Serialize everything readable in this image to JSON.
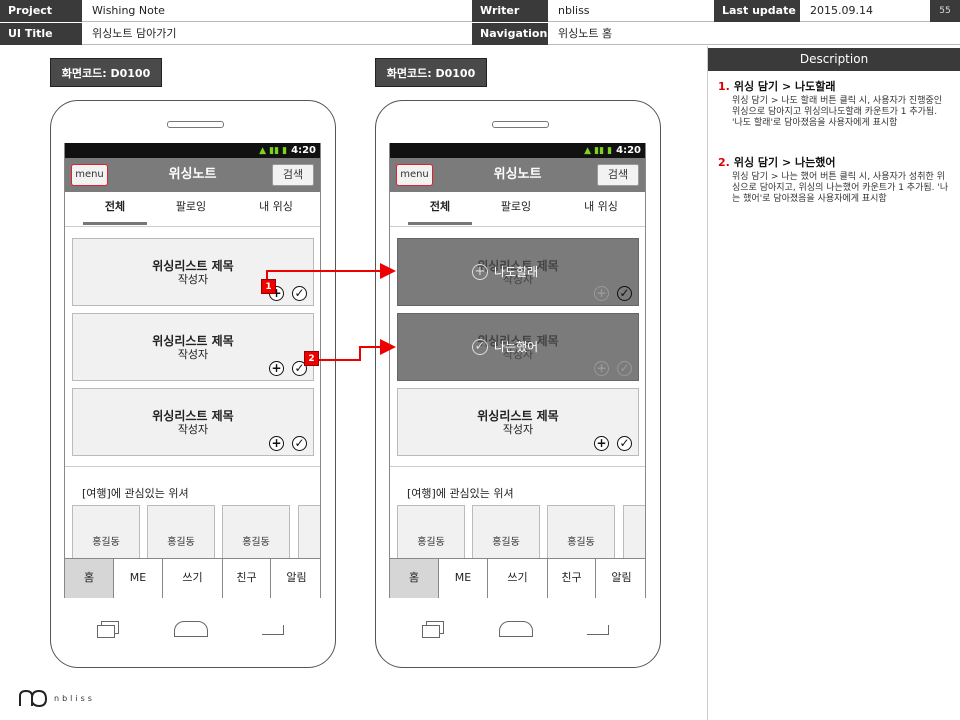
{
  "header": {
    "project_label": "Project",
    "project_value": "Wishing Note",
    "writer_label": "Writer",
    "writer_value": "nbliss",
    "last_update_label": "Last update",
    "last_update_value": "2015.09.14",
    "page_number": "55",
    "ui_title_label": "UI Title",
    "ui_title_value": "위싱노트 담아가기",
    "navigation_label": "Navigation",
    "navigation_value": "위싱노트 홈"
  },
  "screens": [
    {
      "code": "화면코드: D0100"
    },
    {
      "code": "화면코드: D0100"
    }
  ],
  "app": {
    "status_time": "4:20",
    "menu_label": "menu",
    "title": "위싱노트",
    "search_label": "검색",
    "tabs": [
      "전체",
      "팔로잉",
      "내 위싱"
    ],
    "card_title": "위싱리스트 제목",
    "card_author": "작성자",
    "add_symbol": "+",
    "done_symbol": "✓",
    "interest_text": "[여행]에 관심있는 위셔",
    "persons": [
      "홍길동",
      "홍길동",
      "홍길동"
    ],
    "bottom_nav": [
      "홈",
      "ME",
      "쓰기",
      "친구",
      "알림"
    ],
    "overlay_me_too": "나도할래",
    "overlay_done": "나는했어"
  },
  "badges": [
    "1",
    "2"
  ],
  "colors": {
    "accent": "#e00000",
    "header_dark": "#3a3a3a",
    "appbar": "#7b7b7b"
  },
  "description": {
    "title": "Description",
    "items": [
      {
        "num": "1.",
        "title": "위싱 담기 > 나도할래",
        "body": "위싱 담기 > 나도 할래 버튼 클릭 시, 사용자가 진행중인 위싱으로 담아지고 위싱의나도할래 카운트가 1 추가됨. '나도 할래'로 담아졌음을 사용자에게 표시함"
      },
      {
        "num": "2.",
        "title": "위싱 담기 > 나는했어",
        "body": "위싱 담기 > 나는 했어 버튼 클릭 시, 사용자가 성취한 위싱으로 담아지고, 위싱의 나는했어 카운트가 1 추가됨. '나는 했어'로 담아졌음을 사용자에게 표시함"
      }
    ]
  },
  "logo_text": "nbliss"
}
